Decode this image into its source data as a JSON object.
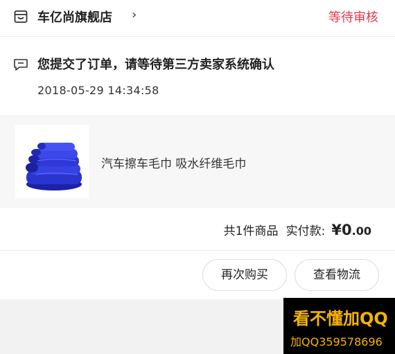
{
  "store": {
    "icon": "store-icon",
    "name": "车亿尚旗舰店",
    "chevron": "›",
    "status": "等待审核",
    "status_color": "#e8384a"
  },
  "notice": {
    "icon": "message-icon",
    "text": "您提交了订单，请等待第三方卖家系统确认",
    "time": "2018-05-29 14:34:58"
  },
  "product": {
    "image": "blue-towels-image",
    "name": "汽车擦车毛巾 吸水纤维毛巾"
  },
  "summary": {
    "count_text": "共1件商品",
    "paid_label": "实付款:",
    "currency": "¥",
    "amount_int": "0",
    "amount_dec": ".00"
  },
  "actions": {
    "rebuy_label": "再次购买",
    "logistics_label": "查看物流"
  },
  "watermark": {
    "line1": "看不懂加QQ",
    "line2": "加QQ359578696",
    "color": "#f5b400"
  }
}
